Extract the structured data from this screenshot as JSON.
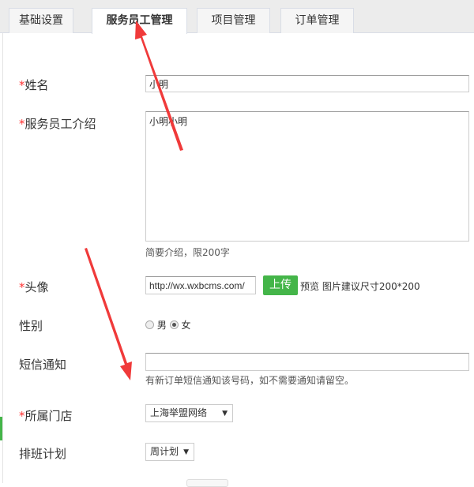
{
  "tabs": [
    {
      "label": "基础设置"
    },
    {
      "label": "服务员工管理",
      "active": true
    },
    {
      "label": "项目管理"
    },
    {
      "label": "订单管理"
    }
  ],
  "form": {
    "required_mark": "*",
    "name": {
      "label": "姓名",
      "value": "小明"
    },
    "intro": {
      "label": "服务员工介绍",
      "value": "小明小明",
      "hint": "简要介绍，限200字"
    },
    "avatar": {
      "label": "头像",
      "value": "http://wx.wxbcms.com/",
      "upload": "上传",
      "preview": "预览",
      "hint": "图片建议尺寸200*200"
    },
    "gender": {
      "label": "性别",
      "options": [
        "男",
        "女"
      ],
      "selected": "女"
    },
    "sms": {
      "label": "短信通知",
      "value": "",
      "hint": "有新订单短信通知该号码，如不需要通知请留空。"
    },
    "store": {
      "label": "所属门店",
      "value": "上海举盟网络"
    },
    "schedule": {
      "label": "排班计划",
      "value": "周计划"
    }
  },
  "colors": {
    "accent": "#44b549",
    "required": "#ff3333",
    "annotation": "#f03a3a"
  }
}
